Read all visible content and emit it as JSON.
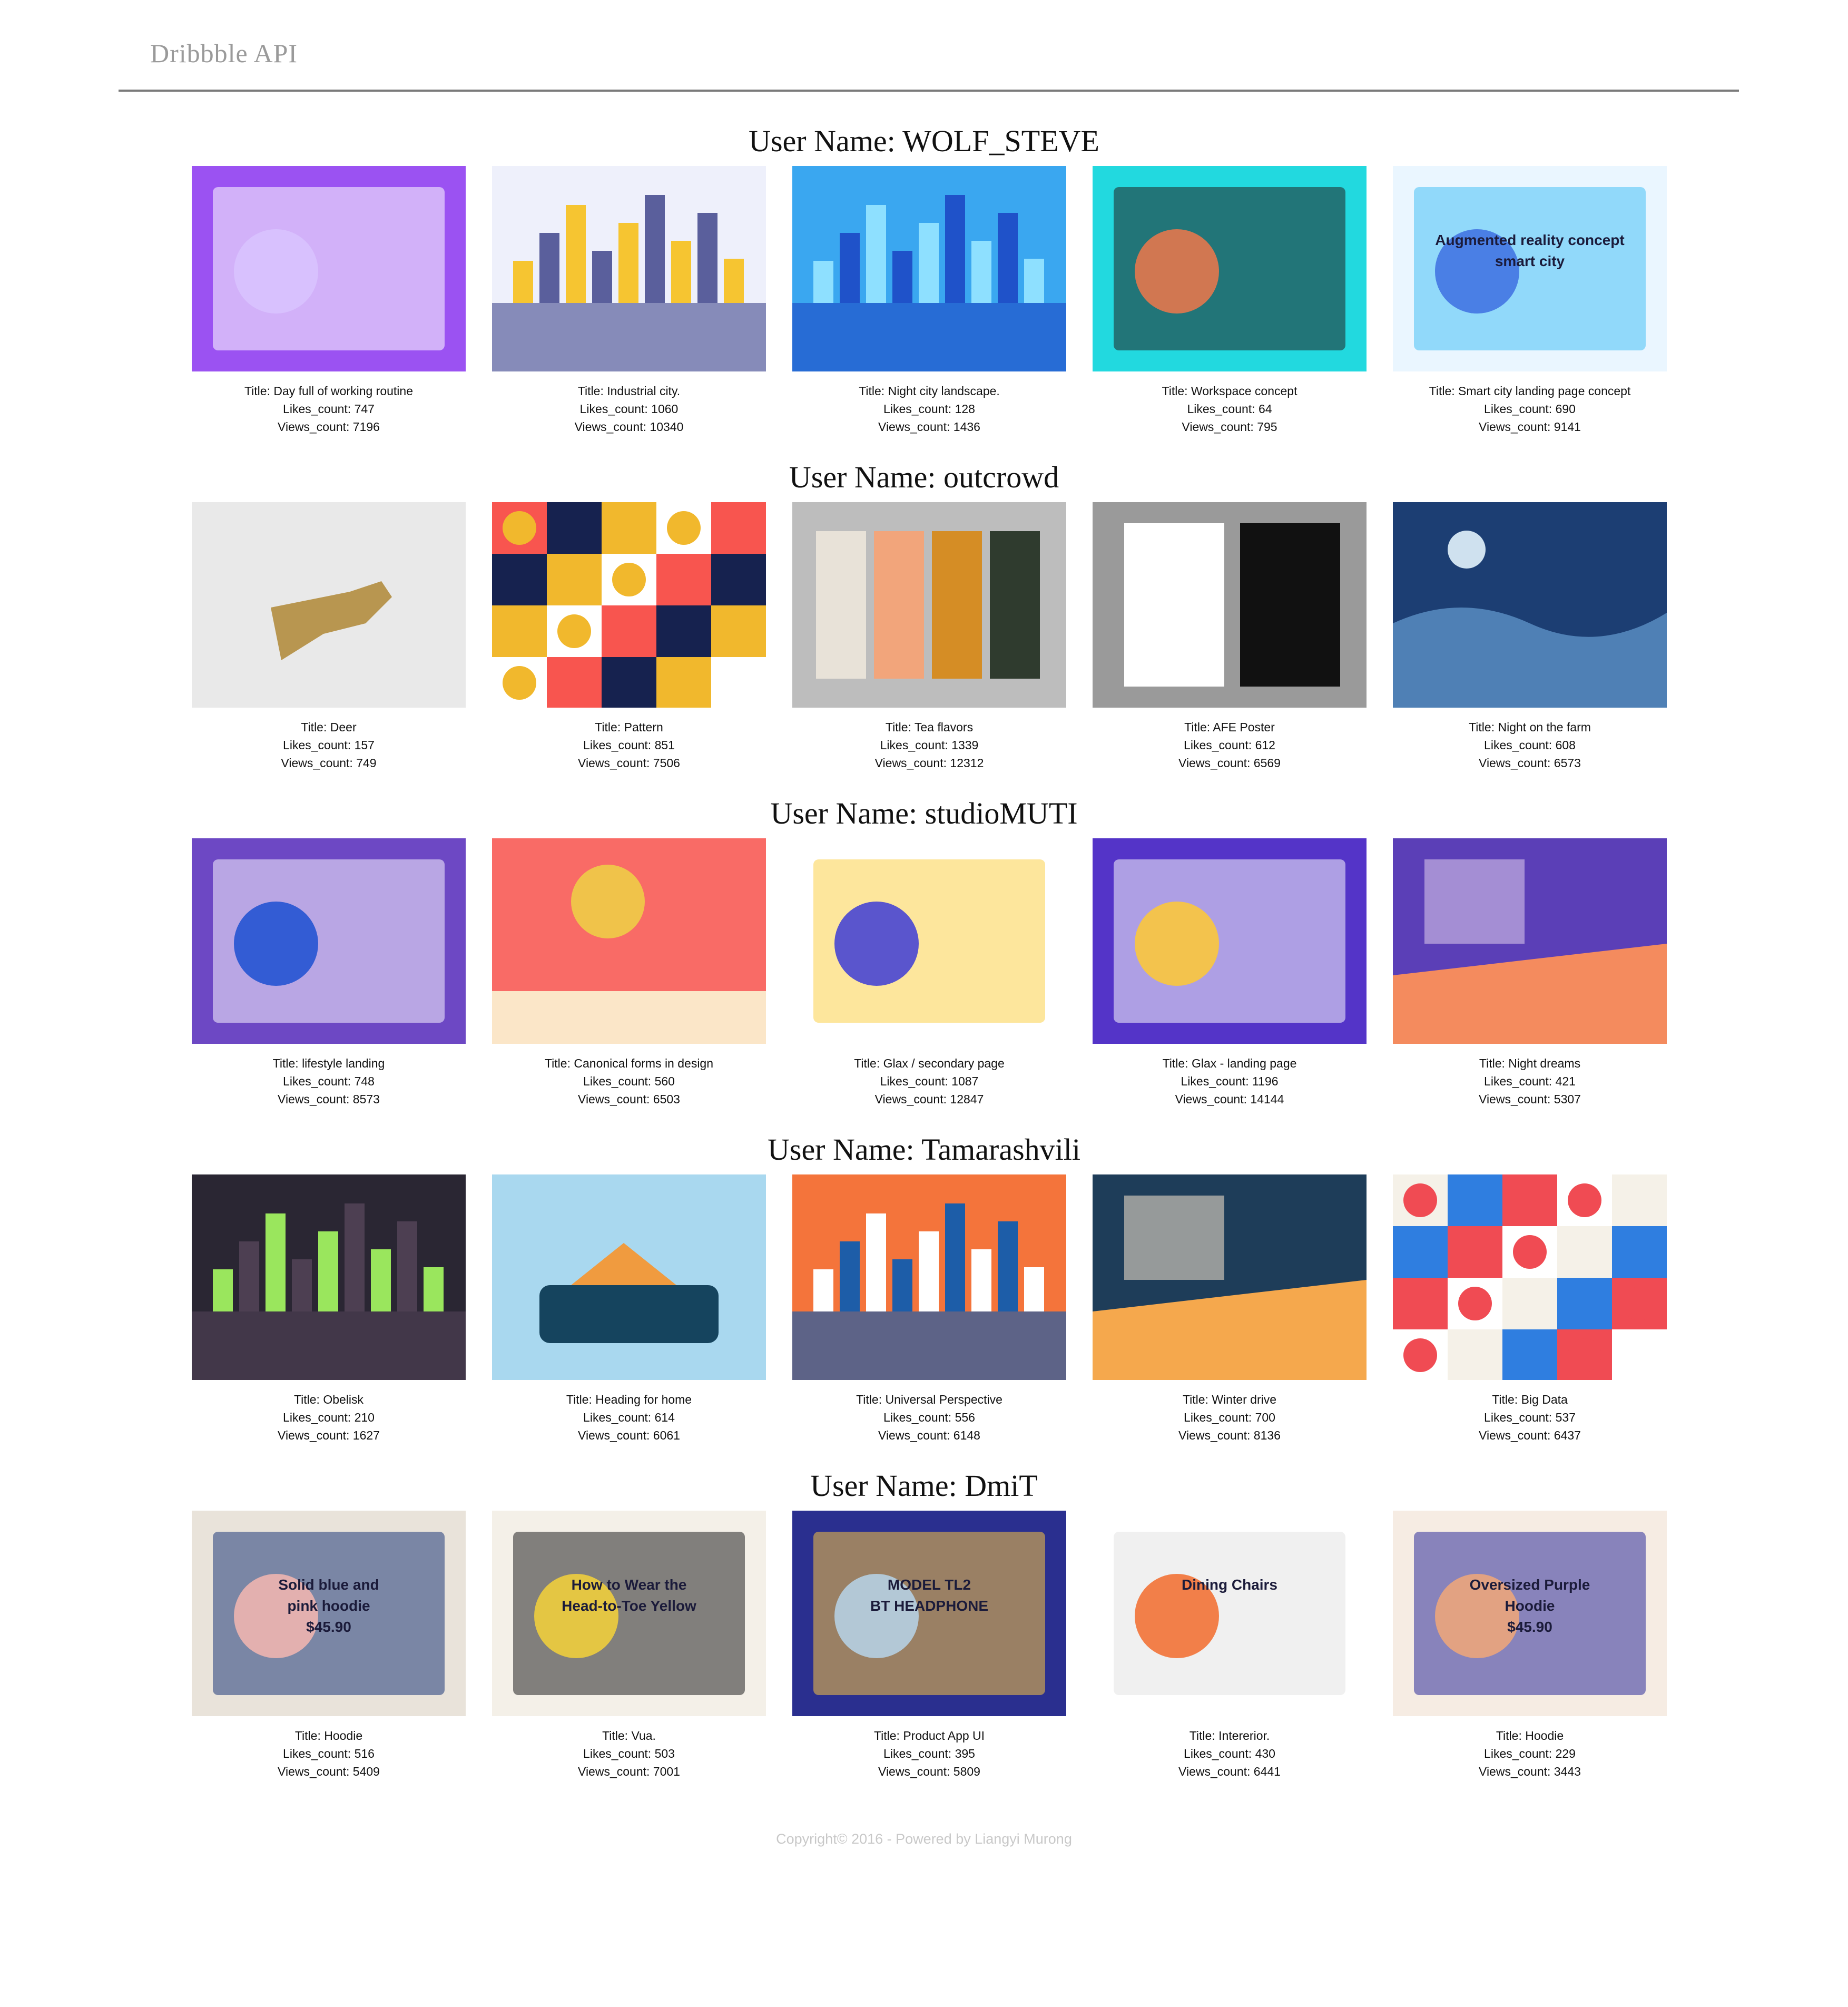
{
  "app": {
    "title": "Dribbble API"
  },
  "labels": {
    "user_prefix": "User Name: ",
    "title_prefix": "Title: ",
    "likes_prefix": "Likes_count: ",
    "views_prefix": "Views_count: "
  },
  "users": [
    {
      "name": "WOLF_STEVE",
      "shots": [
        {
          "title": "Day full of working routine",
          "likes": 747,
          "views": 7196,
          "image": "workstation-isometric-illustration",
          "palette": [
            "#9b52f2",
            "#d9c4ff",
            "#ffffff"
          ]
        },
        {
          "title": "Industrial city.",
          "likes": 1060,
          "views": 10340,
          "image": "isometric-industrial-city-illustration",
          "palette": [
            "#eef0fb",
            "#5a5f9c",
            "#f6c531"
          ]
        },
        {
          "title": "Night city landscape.",
          "likes": 128,
          "views": 1436,
          "image": "night-city-skyline-illustration",
          "palette": [
            "#3aa7f0",
            "#1f52c9",
            "#8ee0ff"
          ]
        },
        {
          "title": "Workspace concept",
          "likes": 64,
          "views": 795,
          "image": "isometric-workspace-desk-illustration",
          "palette": [
            "#22d9df",
            "#f0784a",
            "#222"
          ]
        },
        {
          "title": "Smart city landing page concept",
          "likes": 690,
          "views": 9141,
          "image": "augmented-reality-landing-page",
          "palette": [
            "#eaf6ff",
            "#3d6fe0",
            "#47c1f5"
          ],
          "image_text": [
            "Augmented reality concept",
            "smart city"
          ]
        }
      ]
    },
    {
      "name": "outcrowd",
      "shots": [
        {
          "title": "Deer",
          "likes": 157,
          "views": 749,
          "image": "deer-illustration",
          "palette": [
            "#e9e9e9",
            "#b89650",
            "#2e3a2a"
          ]
        },
        {
          "title": "Pattern",
          "likes": 851,
          "views": 7506,
          "image": "geometric-pattern",
          "palette": [
            "#f8554f",
            "#16224f",
            "#f1b82d"
          ]
        },
        {
          "title": "Tea flavors",
          "likes": 1339,
          "views": 12312,
          "image": "tea-packaging-mockup",
          "palette": [
            "#bdbdbd",
            "#f2a57b",
            "#d58d25"
          ]
        },
        {
          "title": "AFE Poster",
          "likes": 612,
          "views": 6569,
          "image": "typographic-poster-mockup",
          "palette": [
            "#9a9a9a",
            "#ffffff",
            "#111111"
          ]
        },
        {
          "title": "Night on the farm",
          "likes": 608,
          "views": 6573,
          "image": "night-farm-landscape",
          "palette": [
            "#1c3e73",
            "#4f80b5",
            "#cfe1ef"
          ]
        }
      ]
    },
    {
      "name": "studioMUTI",
      "shots": [
        {
          "title": "lifestyle landing",
          "likes": 748,
          "views": 8573,
          "image": "lifestyle-landing-page",
          "palette": [
            "#6d48c4",
            "#1b4fd1",
            "#f7f4ff"
          ]
        },
        {
          "title": "Canonical forms in design",
          "likes": 560,
          "views": 6503,
          "image": "canonical-forms-illustration",
          "palette": [
            "#f96b66",
            "#fbe6c8",
            "#f0c34a"
          ]
        },
        {
          "title": "Glax / secondary page",
          "likes": 1087,
          "views": 12847,
          "image": "space-website-secondary-page",
          "palette": [
            "#ffffff",
            "#3d3bd6",
            "#fbd14a"
          ]
        },
        {
          "title": "Glax - landing page",
          "likes": 1196,
          "views": 14144,
          "image": "space-website-landing-page",
          "palette": [
            "#5434c8",
            "#ffc933",
            "#f7f7fb"
          ]
        },
        {
          "title": "Night dreams",
          "likes": 421,
          "views": 5307,
          "image": "night-dreams-illustration",
          "palette": [
            "#5b3fb7",
            "#f48b5e",
            "#d5c3e8"
          ]
        }
      ]
    },
    {
      "name": "Tamarashvili",
      "shots": [
        {
          "title": "Obelisk",
          "likes": 210,
          "views": 1627,
          "image": "obelisk-isometric-city",
          "palette": [
            "#2a2633",
            "#4d3f52",
            "#9ae65d"
          ]
        },
        {
          "title": "Heading for home",
          "likes": 614,
          "views": 6061,
          "image": "van-with-christmas-tree",
          "palette": [
            "#a9d8ef",
            "#f09b3f",
            "#15445e"
          ]
        },
        {
          "title": "Universal Perspective",
          "likes": 556,
          "views": 6148,
          "image": "colorful-city-illustration",
          "palette": [
            "#f4743b",
            "#1d5da8",
            "#ffffff"
          ]
        },
        {
          "title": "Winter drive",
          "likes": 700,
          "views": 8136,
          "image": "winter-drive-illustration",
          "palette": [
            "#1e3d59",
            "#f5a84d",
            "#e6d9c7"
          ]
        },
        {
          "title": "Big Data",
          "likes": 537,
          "views": 6437,
          "image": "big-data-illustration",
          "palette": [
            "#f5f1e8",
            "#2f7ee0",
            "#f04b53"
          ]
        }
      ]
    },
    {
      "name": "DmiT",
      "shots": [
        {
          "title": "Hoodie",
          "likes": 516,
          "views": 5409,
          "image": "hoodie-store-page",
          "palette": [
            "#e9e3da",
            "#f6b7b0",
            "#1f3a7a"
          ],
          "image_text": [
            "Solid blue and",
            "pink  hoodie",
            "$45.90"
          ]
        },
        {
          "title": "Vua.",
          "likes": 503,
          "views": 7001,
          "image": "fashion-blog-page",
          "palette": [
            "#f4f0e8",
            "#f6d23a",
            "#222222"
          ],
          "image_text": [
            "How to Wear the",
            "Head-to-Toe Yellow"
          ]
        },
        {
          "title": "Product App UI",
          "likes": 395,
          "views": 5809,
          "image": "product-app-ui",
          "palette": [
            "#2a2f8f",
            "#b7d5ea",
            "#f5c342"
          ],
          "image_text": [
            "MODEL TL2",
            "BT HEADPHONE"
          ]
        },
        {
          "title": "Intererior.",
          "likes": 430,
          "views": 6441,
          "image": "interior-dining-chairs-page",
          "palette": [
            "#ffffff",
            "#f26b2b",
            "#e3e3e3"
          ],
          "image_text": [
            "Dining Chairs"
          ]
        },
        {
          "title": "Hoodie",
          "likes": 229,
          "views": 3443,
          "image": "oversized-hoodie-store-page",
          "palette": [
            "#f6ece3",
            "#f2a878",
            "#2d2e9a"
          ],
          "image_text": [
            "Oversized Purple",
            "Hoodie",
            "$45.90"
          ]
        }
      ]
    }
  ],
  "footer": {
    "text": "Copyright© 2016 - Powered by Liangyi Murong"
  }
}
